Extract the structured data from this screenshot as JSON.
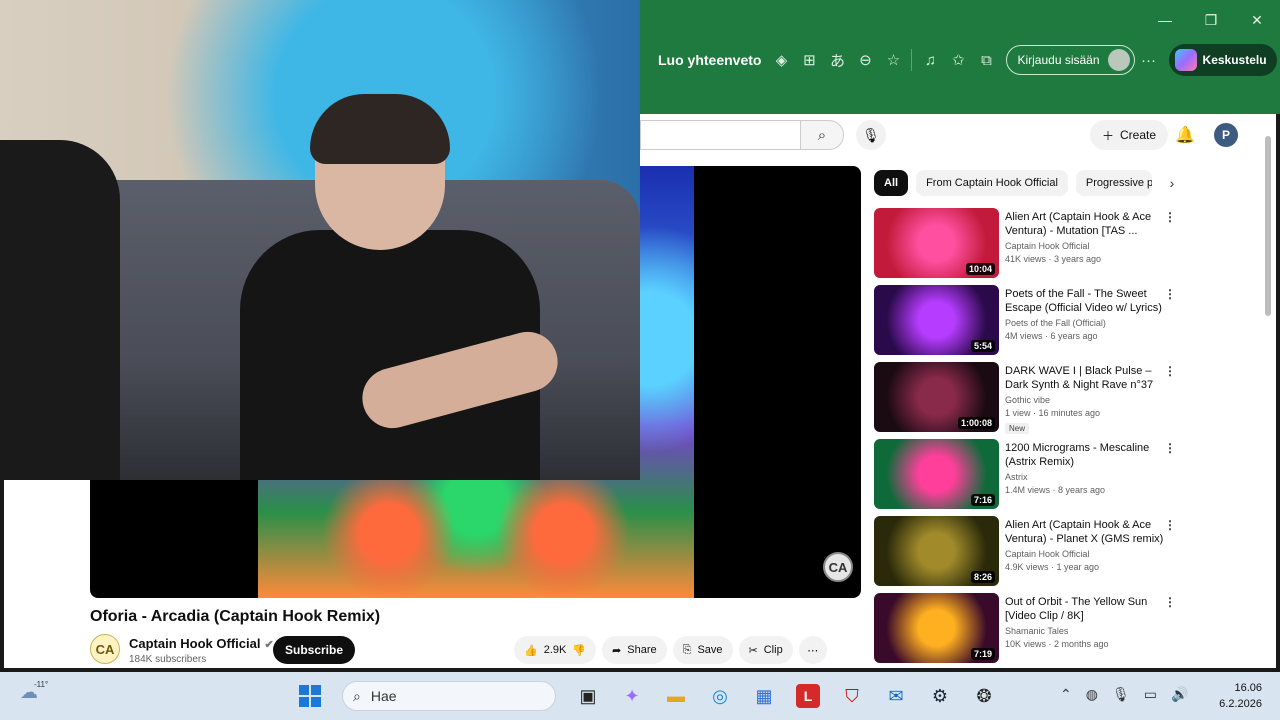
{
  "window": {
    "controls": [
      "—",
      "❐",
      "✕"
    ]
  },
  "browser": {
    "page_title": "Luo yhteenveto",
    "signin_label": "Kirjaudu sisään",
    "copilot_label": "Keskustelu"
  },
  "youtube": {
    "create_label": "Create",
    "avatar_letter": "P",
    "video": {
      "title": "Oforia - Arcadia (Captain Hook Remix)",
      "channel": "Captain Hook Official",
      "subscribers": "184K subscribers",
      "subscribe_label": "Subscribe",
      "likes": "2.9K",
      "share_label": "Share",
      "save_label": "Save",
      "clip_label": "Clip"
    },
    "chips": [
      "All",
      "From Captain Hook Official",
      "Progressive p"
    ],
    "recommendations": [
      {
        "title": "Alien Art (Captain Hook & Ace Ventura) - Mutation [TAS ...",
        "channel": "Captain Hook Official",
        "meta": "41K views · 3 years ago",
        "duration": "10:04",
        "new": "",
        "c1": "#c21a3a",
        "c2": "#ff4fa0"
      },
      {
        "title": "Poets of the Fall - The Sweet Escape (Official Video w/ Lyrics)",
        "channel": "Poets of the Fall (Official)",
        "meta": "4M views · 6 years ago",
        "duration": "5:54",
        "new": "",
        "c1": "#2a0a4a",
        "c2": "#b63cff"
      },
      {
        "title": "DARK WAVE I | Black Pulse – Dark Synth & Night Rave n°37",
        "channel": "Gothic vibe",
        "meta": "1 view · 16 minutes ago",
        "duration": "1:00:08",
        "new": "New",
        "c1": "#1a0a12",
        "c2": "#8a2a4a"
      },
      {
        "title": "1200 Micrograms - Mescaline (Astrix Remix)",
        "channel": "Astrix",
        "meta": "1.4M views · 8 years ago",
        "duration": "7:16",
        "new": "",
        "c1": "#0f6a3a",
        "c2": "#ff3f9a"
      },
      {
        "title": "Alien Art (Captain Hook & Ace Ventura) - Planet X (GMS remix)",
        "channel": "Captain Hook Official",
        "meta": "4.9K views · 1 year ago",
        "duration": "8:26",
        "new": "",
        "c1": "#2a2a0a",
        "c2": "#a08a2a"
      },
      {
        "title": "Out of Orbit - The Yellow Sun [Video Clip / 8K]",
        "channel": "Shamanic Tales",
        "meta": "10K views · 2 months ago",
        "duration": "7:19",
        "new": "",
        "c1": "#3a0a2a",
        "c2": "#ffb020"
      }
    ]
  },
  "taskbar": {
    "weather_temp": "-11°",
    "search_placeholder": "Hae",
    "time": "16.06",
    "date": "6.2.2026"
  }
}
